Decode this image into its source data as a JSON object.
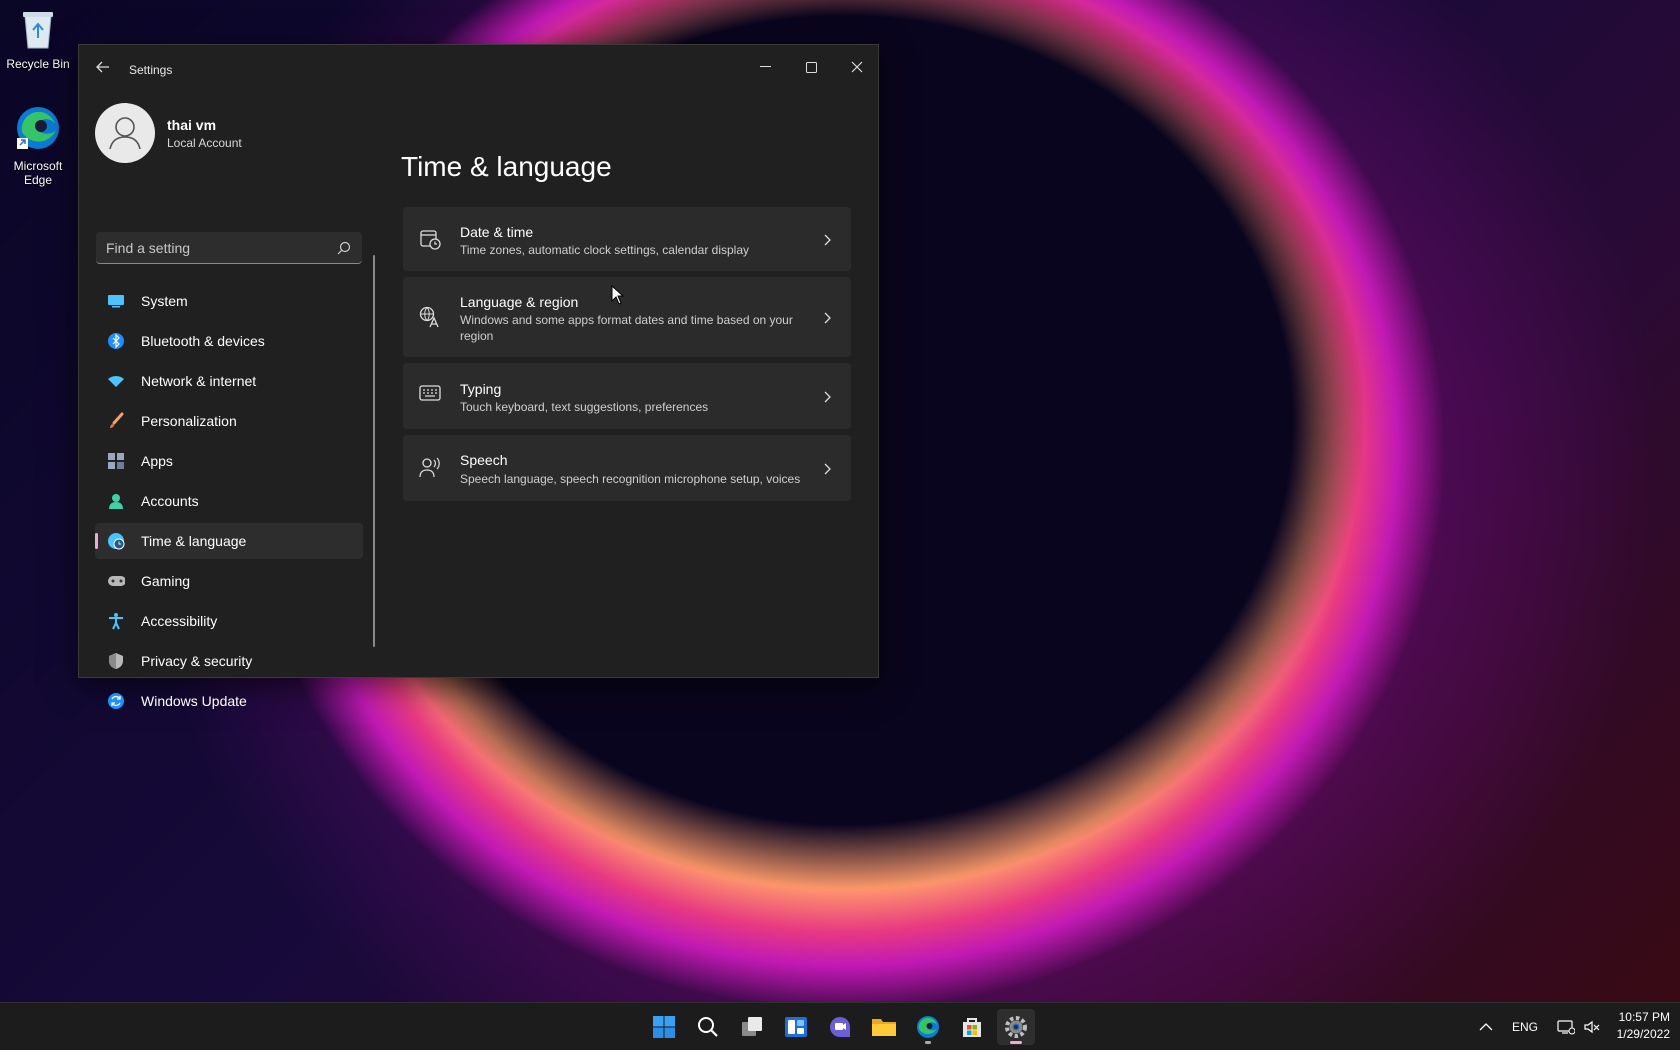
{
  "desktop": {
    "icons": [
      {
        "label": "Recycle Bin",
        "icon": "recycle-bin-icon"
      },
      {
        "label": "Microsoft Edge",
        "icon": "edge-icon"
      }
    ]
  },
  "window": {
    "title": "Settings",
    "controls": [
      "minimize",
      "maximize",
      "close"
    ],
    "profile": {
      "name": "thai vm",
      "account_type": "Local Account"
    },
    "search": {
      "placeholder": "Find a setting"
    },
    "nav": [
      {
        "label": "System",
        "icon": "monitor-icon",
        "color": "#4cc2ff"
      },
      {
        "label": "Bluetooth & devices",
        "icon": "bluetooth-icon",
        "color": "#1e8fff"
      },
      {
        "label": "Network & internet",
        "icon": "wifi-icon",
        "color": "#4cc2ff"
      },
      {
        "label": "Personalization",
        "icon": "paintbrush-icon",
        "color": "#f2a36c"
      },
      {
        "label": "Apps",
        "icon": "apps-icon",
        "color": "#9aa7bf"
      },
      {
        "label": "Accounts",
        "icon": "person-icon",
        "color": "#3fd0a8"
      },
      {
        "label": "Time & language",
        "icon": "globe-clock-icon",
        "color": "#4cc2ff",
        "active": true
      },
      {
        "label": "Gaming",
        "icon": "gamepad-icon",
        "color": "#b8b8b8"
      },
      {
        "label": "Accessibility",
        "icon": "accessibility-icon",
        "color": "#4cc2ff"
      },
      {
        "label": "Privacy & security",
        "icon": "shield-icon",
        "color": "#b8b8b8"
      },
      {
        "label": "Windows Update",
        "icon": "update-icon",
        "color": "#4cc2ff"
      }
    ],
    "page_title": "Time & language",
    "cards": [
      {
        "title": "Date & time",
        "desc": "Time zones, automatic clock settings, calendar display",
        "icon": "calendar-clock-icon"
      },
      {
        "title": "Language & region",
        "desc": "Windows and some apps format dates and time based on your region",
        "icon": "language-icon"
      },
      {
        "title": "Typing",
        "desc": "Touch keyboard, text suggestions, preferences",
        "icon": "keyboard-icon"
      },
      {
        "title": "Speech",
        "desc": "Speech language, speech recognition microphone setup, voices",
        "icon": "speech-icon"
      }
    ]
  },
  "taskbar": {
    "apps": [
      "start",
      "search",
      "task-view",
      "widgets",
      "chat",
      "file-explorer",
      "edge",
      "store",
      "settings"
    ],
    "active_app": "settings",
    "tray": {
      "language": "ENG",
      "time": "10:57 PM",
      "date": "1/29/2022"
    }
  },
  "colors": {
    "accent": "#f0a8d8",
    "window_bg": "#202020",
    "card_bg": "#2b2b2b"
  }
}
